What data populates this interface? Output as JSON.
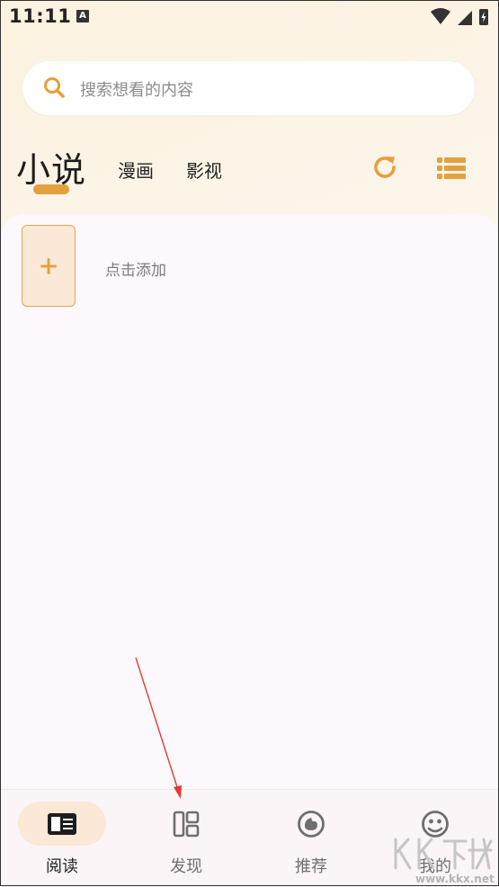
{
  "status_bar": {
    "time": "11:11",
    "notification_glyph": "A",
    "icons": [
      "wifi-icon",
      "signal-icon",
      "battery-charging-icon"
    ]
  },
  "search": {
    "placeholder": "搜索想看的内容",
    "icon": "search-icon"
  },
  "tabs": [
    {
      "label": "小说",
      "selected": true
    },
    {
      "label": "漫画",
      "selected": false
    },
    {
      "label": "影视",
      "selected": false
    }
  ],
  "toolbar": {
    "refresh_icon": "refresh-icon",
    "list_icon": "list-icon"
  },
  "bookshelf": {
    "add_label": "点击添加",
    "add_icon": "plus-icon"
  },
  "bottom_nav": [
    {
      "label": "阅读",
      "icon": "book-icon",
      "active": true
    },
    {
      "label": "发现",
      "icon": "layout-icon",
      "active": false
    },
    {
      "label": "推荐",
      "icon": "like-icon",
      "active": false
    },
    {
      "label": "我的",
      "icon": "profile-icon",
      "active": false
    }
  ],
  "watermark": {
    "text": "www.kkx.net",
    "logo": "KK下载"
  },
  "colors": {
    "accent": "#e4a03d",
    "accent_light": "#fbe8d6",
    "panel": "#fdf8fc",
    "annotation": "#e53935"
  }
}
